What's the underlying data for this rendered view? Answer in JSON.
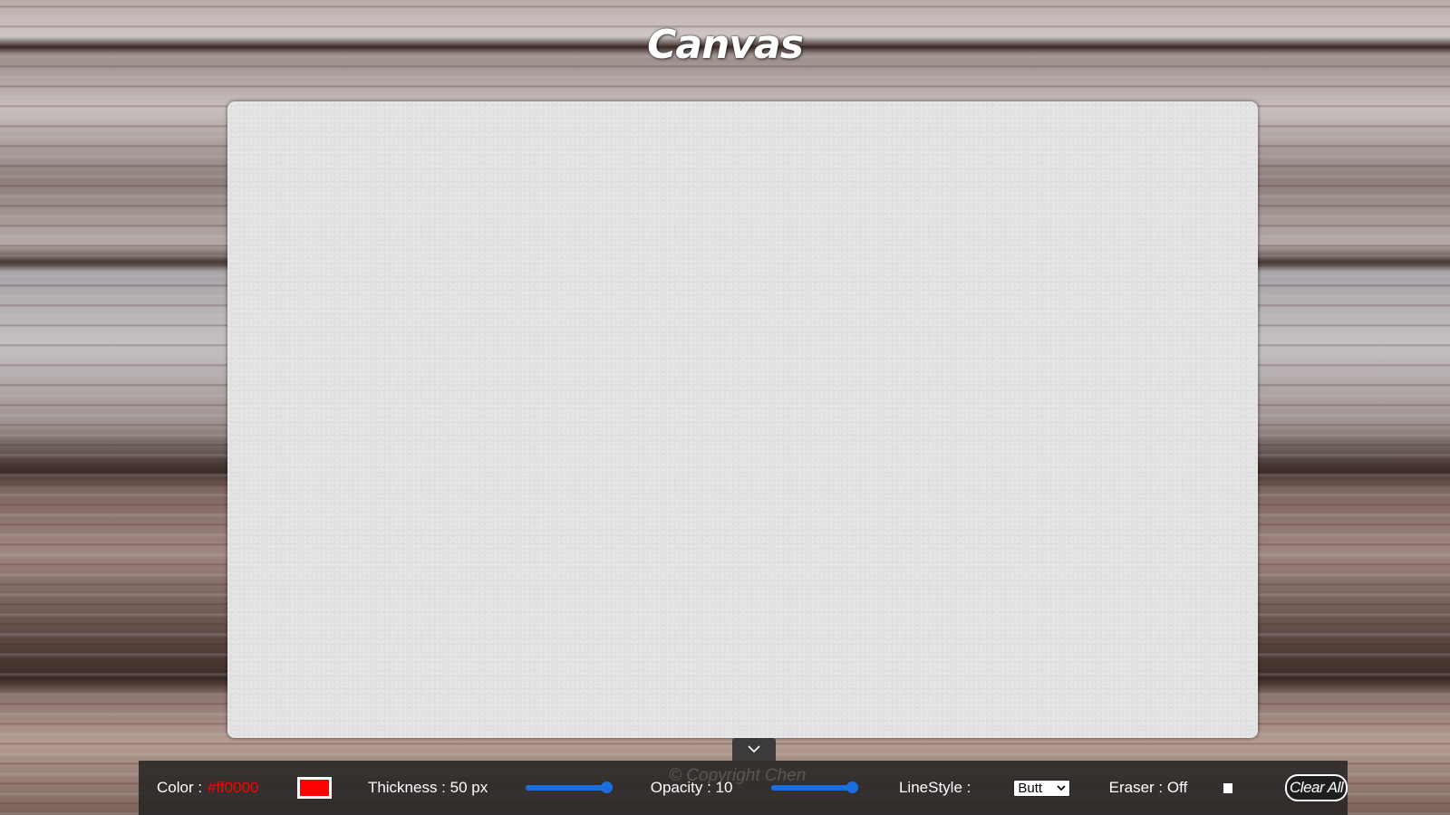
{
  "app": {
    "title": "Canvas",
    "watermark": "© Copyright Chen"
  },
  "toolbar": {
    "color_label": "Color :",
    "color_value": "#ff0000",
    "current_color": "#ff0000",
    "thickness_label": "Thickness : 50 px",
    "thickness_slider_level": 1.0,
    "opacity_label": "Opacity : 10",
    "opacity_slider_level": 1.0,
    "linestyle_label": "LineStyle :",
    "linestyle_selected": "Butt",
    "eraser_label": "Eraser : Off",
    "clear_label": "Clear All"
  },
  "icons": {
    "toggle": "chevron-down-icon"
  },
  "colors": {
    "accent": "#1a6fe0",
    "toolbar_bg": "#282626",
    "canvas_bg": "#e2e2e2"
  }
}
